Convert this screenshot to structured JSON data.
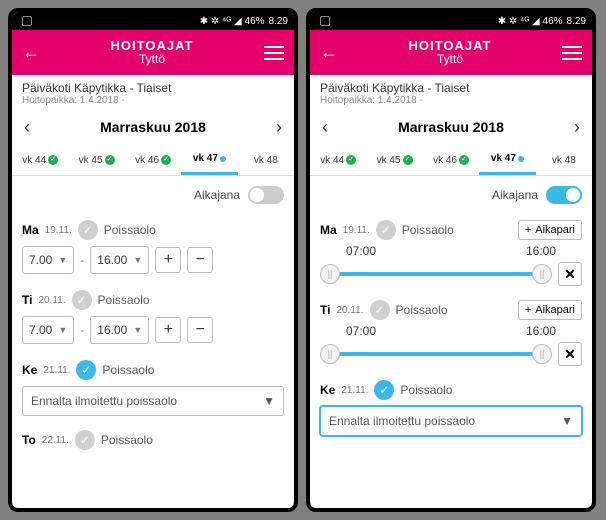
{
  "status": {
    "icons": "✱ ✲ ⁴ᴳ ◢ 46%",
    "time": "8.29"
  },
  "appbar": {
    "title": "HOITOAJAT",
    "subtitle": "Tyttö"
  },
  "subheader": {
    "place": "Päiväkoti Käpytikka - Tiaiset",
    "since": "Hoitopaikka: 1.4.2018 -"
  },
  "month": "Marraskuu 2018",
  "weeks": {
    "w0": "vk 44",
    "w1": "vk 45",
    "w2": "vk 46",
    "w3": "vk 47",
    "w4": "vk 48"
  },
  "toggle_label": "Aikajana",
  "labels": {
    "poissaolo": "Poissaolo",
    "aikapari": "Aikapari",
    "ennalta": "Ennalta ilmoitettu poissaolo"
  },
  "left": {
    "days": {
      "d0": {
        "name": "Ma",
        "date": "19.11.",
        "start": "7.00",
        "end": "16.00"
      },
      "d1": {
        "name": "Ti",
        "date": "20.11.",
        "start": "7.00",
        "end": "16.00"
      },
      "d2": {
        "name": "Ke",
        "date": "21.11."
      },
      "d3": {
        "name": "To",
        "date": "22.11."
      }
    }
  },
  "right": {
    "days": {
      "d0": {
        "name": "Ma",
        "date": "19.11.",
        "start": "07:00",
        "end": "16:00"
      },
      "d1": {
        "name": "Ti",
        "date": "20.11.",
        "start": "07:00",
        "end": "16:00"
      },
      "d2": {
        "name": "Ke",
        "date": "21.11."
      }
    }
  }
}
